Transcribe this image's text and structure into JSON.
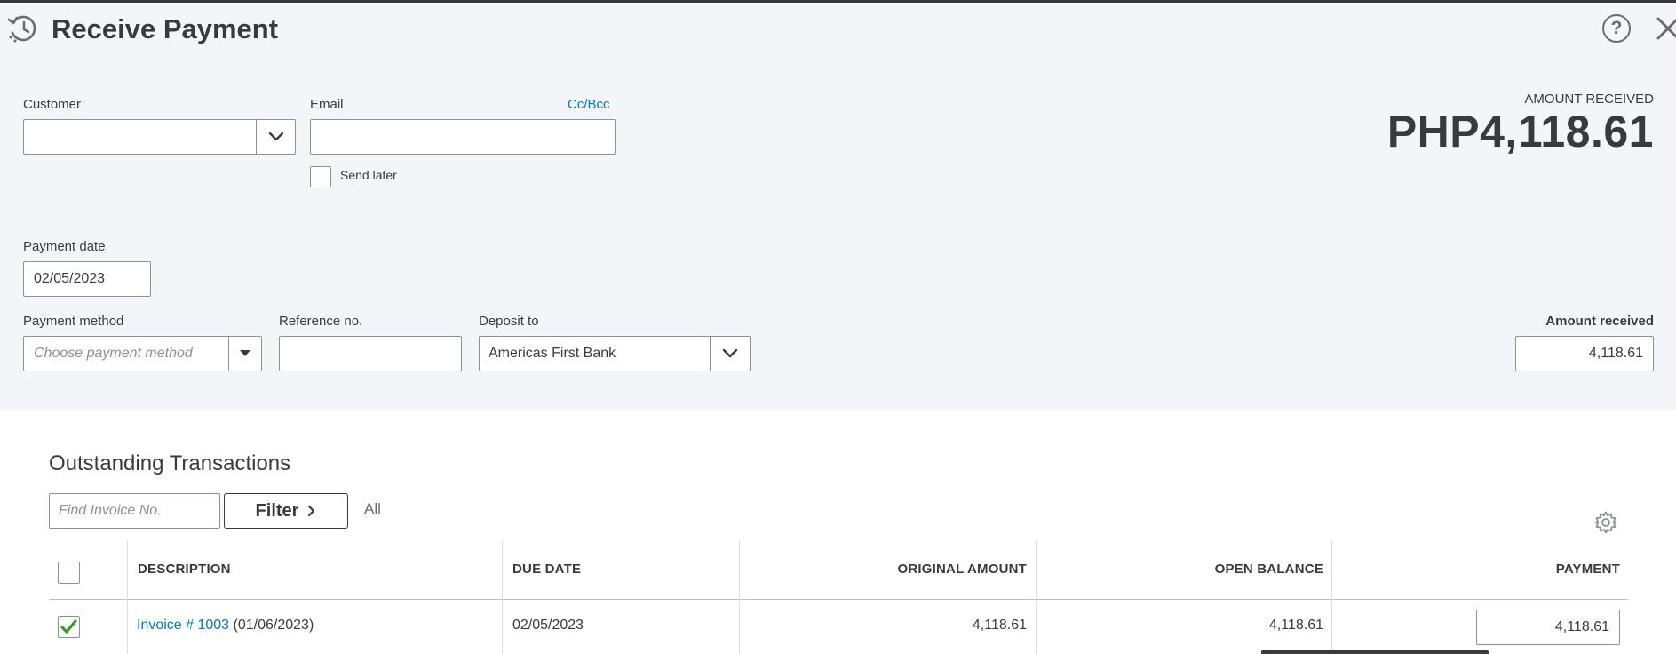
{
  "header": {
    "title": "Receive Payment",
    "help_glyph": "?"
  },
  "icons": {
    "history": "history-icon",
    "help": "help-icon",
    "close": "close-icon",
    "chevron": "chevron-down-icon",
    "caret": "caret-down-icon",
    "gear": "gear-icon",
    "check": "check-icon",
    "chevron_right": "chevron-right-icon"
  },
  "form": {
    "customer_label": "Customer",
    "customer_value": "",
    "email_label": "Email",
    "ccbcc_label": "Cc/Bcc",
    "email_value": "",
    "send_later_label": "Send later",
    "payment_date_label": "Payment date",
    "payment_date_value": "02/05/2023",
    "payment_method_label": "Payment method",
    "payment_method_placeholder": "Choose payment method",
    "reference_label": "Reference no.",
    "reference_value": "",
    "deposit_to_label": "Deposit to",
    "deposit_to_value": "Americas First Bank",
    "amount_received_label": "Amount received",
    "amount_received_value": "4,118.61"
  },
  "summary": {
    "amount_received_caption": "AMOUNT RECEIVED",
    "amount_received_total": "PHP4,118.61"
  },
  "outstanding": {
    "title": "Outstanding Transactions",
    "find_placeholder": "Find Invoice No.",
    "filter_label": "Filter",
    "all_label": "All",
    "columns": [
      "DESCRIPTION",
      "DUE DATE",
      "ORIGINAL AMOUNT",
      "OPEN BALANCE",
      "PAYMENT"
    ],
    "rows": [
      {
        "checked": true,
        "invoice_link": "Invoice # 1003",
        "invoice_date": "(01/06/2023)",
        "due_date": "02/05/2023",
        "original_amount": "4,118.61",
        "open_balance": "4,118.61",
        "payment": "4,118.61"
      }
    ]
  },
  "colors": {
    "panel_bg": "#f4f5f8",
    "link": "#0077c5",
    "check_green": "#2ca01c",
    "text": "#393a3d"
  }
}
